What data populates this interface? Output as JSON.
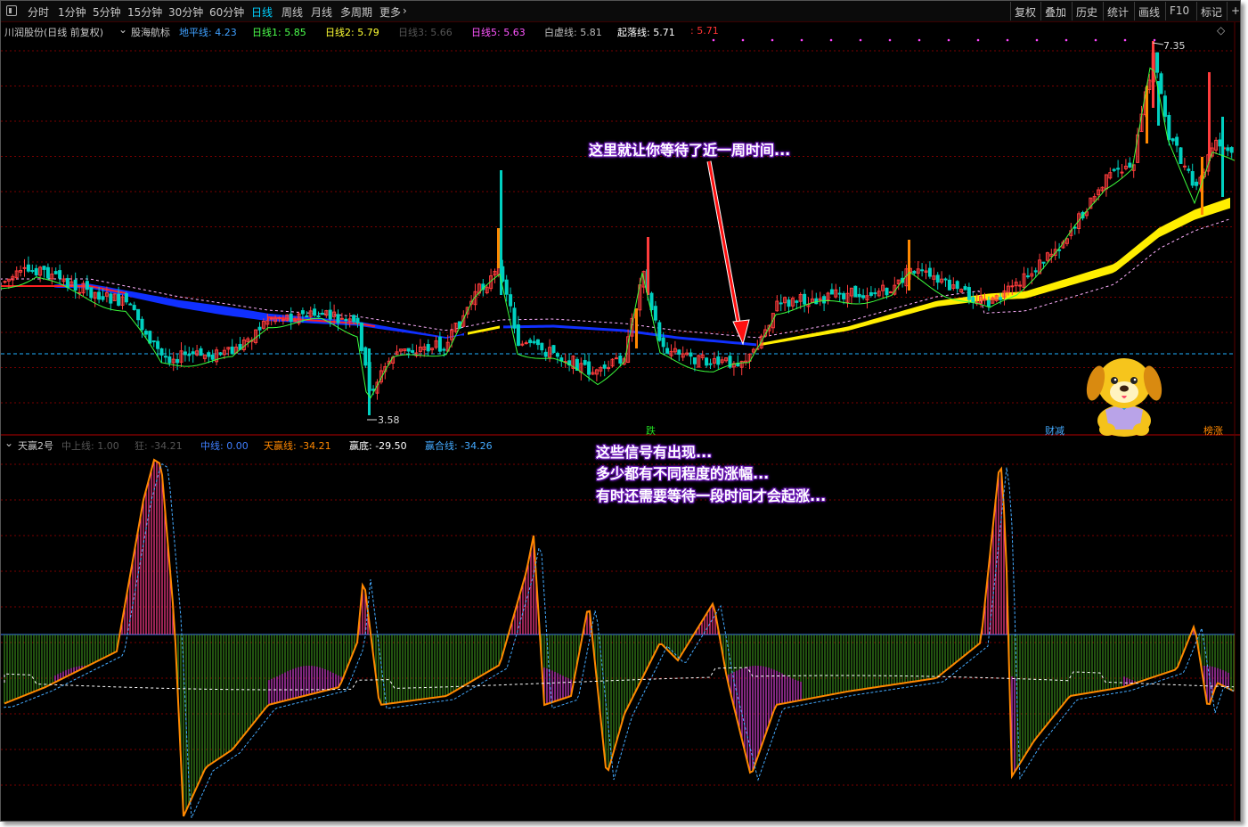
{
  "toolbar": {
    "periods": [
      "分时",
      "1分钟",
      "5分钟",
      "15分钟",
      "30分钟",
      "60分钟",
      "日线",
      "周线",
      "月线",
      "多周期",
      "更多"
    ],
    "active_period": "日线",
    "more_chevron": "›",
    "right_buttons": [
      "复权",
      "叠加",
      "历史",
      "统计",
      "画线",
      "F10",
      "标记",
      "+"
    ]
  },
  "main_panel": {
    "stock_label": "川润股份(日线 前复权)",
    "indicator_name": "股海航标",
    "legend": [
      {
        "label": "地平线:",
        "value": "4.23",
        "color": "#3fa0ff"
      },
      {
        "label": "日线1:",
        "value": "5.85",
        "color": "#4cff4c"
      },
      {
        "label": "日线2:",
        "value": "5.79",
        "color": "#ffff33"
      },
      {
        "label": "日线3:",
        "value": "5.66",
        "color": "#555555"
      },
      {
        "label": "日线5:",
        "value": "5.63",
        "color": "#ff55ff"
      },
      {
        "label": "白虚线:",
        "value": "5.81",
        "color": "#bbbbbb"
      },
      {
        "label": "起落线:",
        "value": "5.71",
        "color": "#ffffff"
      },
      {
        "label": ":",
        "value": "5.71",
        "color": "#ff3333"
      }
    ],
    "high_label": "7.35",
    "low_label": "3.58",
    "annotation": "这里就让你等待了近一周时间...",
    "signals": [
      {
        "text": "跌",
        "color": "#22dd22"
      },
      {
        "text": "财减",
        "color": "#44aaff"
      },
      {
        "text": "榜涨",
        "color": "#ff8800"
      }
    ]
  },
  "sub_panel": {
    "indicator_name": "天赢2号",
    "legend": [
      {
        "label": "中上线:",
        "value": "1.00",
        "color": "#555555"
      },
      {
        "label": "狂:",
        "value": "-34.21",
        "color": "#555555"
      },
      {
        "label": "中线:",
        "value": "0.00",
        "color": "#3f7fff"
      },
      {
        "label": "天赢线:",
        "value": "-34.21",
        "color": "#ff8800"
      },
      {
        "label": "赢底:",
        "value": "-29.50",
        "color": "#ffffff"
      },
      {
        "label": "赢合线:",
        "value": "-34.26",
        "color": "#44aaff"
      }
    ],
    "annotation_lines": [
      "这些信号有出现...",
      "多少都有不同程度的涨幅...",
      "有时还需要等待一段时间才会起涨..."
    ]
  },
  "colors": {
    "up_candle": "#ff3c3c",
    "down_candle": "#00d0c0",
    "grid": "#7a0000",
    "blue_band": "#1030ff",
    "yellow_band": "#ffee00",
    "cyan_dash": "#20b0ff",
    "pink_bar": "#ff3c8c",
    "green_bar": "#3a8a1a",
    "magenta_bar": "#d030d0",
    "orange_line": "#ff8800"
  },
  "icons": {
    "menu": "menu-square-icon",
    "legend_toggle": "circle-chevron-down-icon",
    "scroll": "diamond-scroll-icon"
  },
  "mascot": "yellow-puppy-mascot"
}
